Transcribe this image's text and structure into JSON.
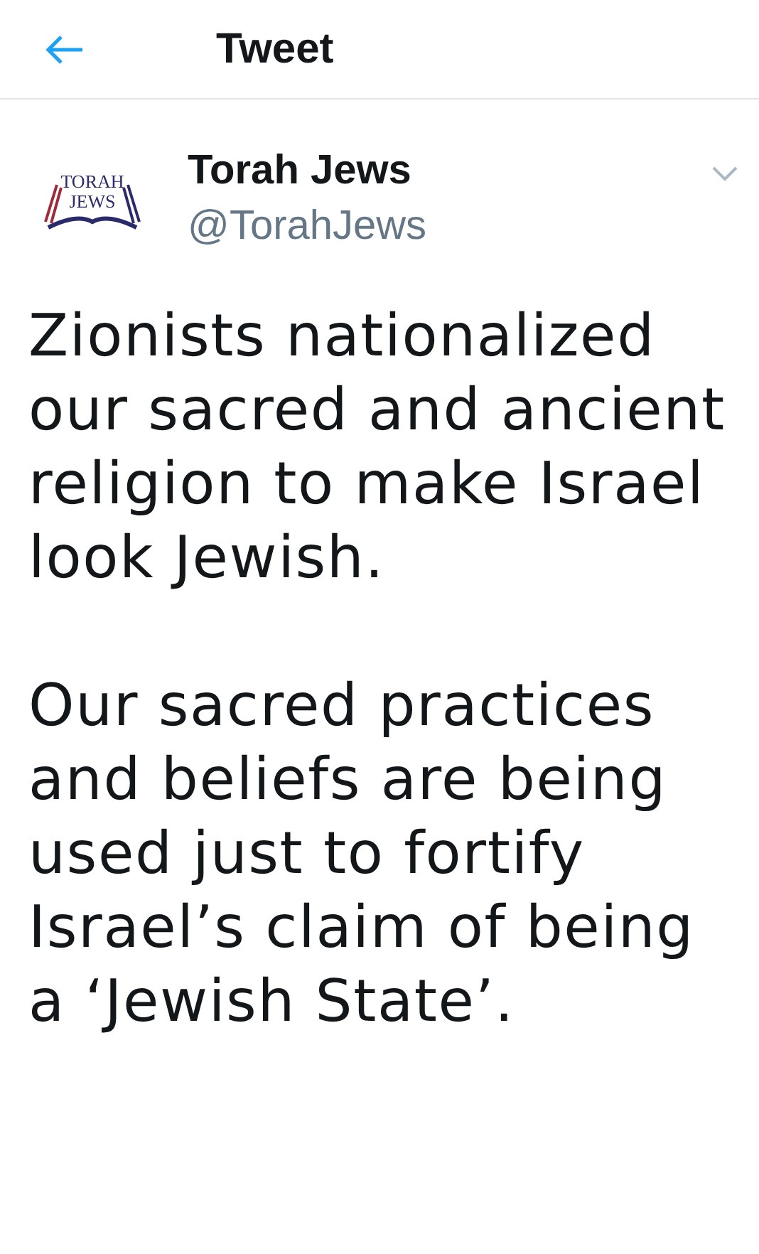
{
  "header": {
    "title": "Tweet"
  },
  "tweet": {
    "avatar_text": [
      "TORAH",
      "JEWS"
    ],
    "name": "Torah Jews",
    "handle": "@TorahJews",
    "paragraphs": [
      "Zionists nationalized our sacred and ancient religion to make Israel look Jewish.",
      "Our sacred practices and beliefs are being used just to fortify Israel’s claim of being a ‘Jewish State’."
    ]
  }
}
